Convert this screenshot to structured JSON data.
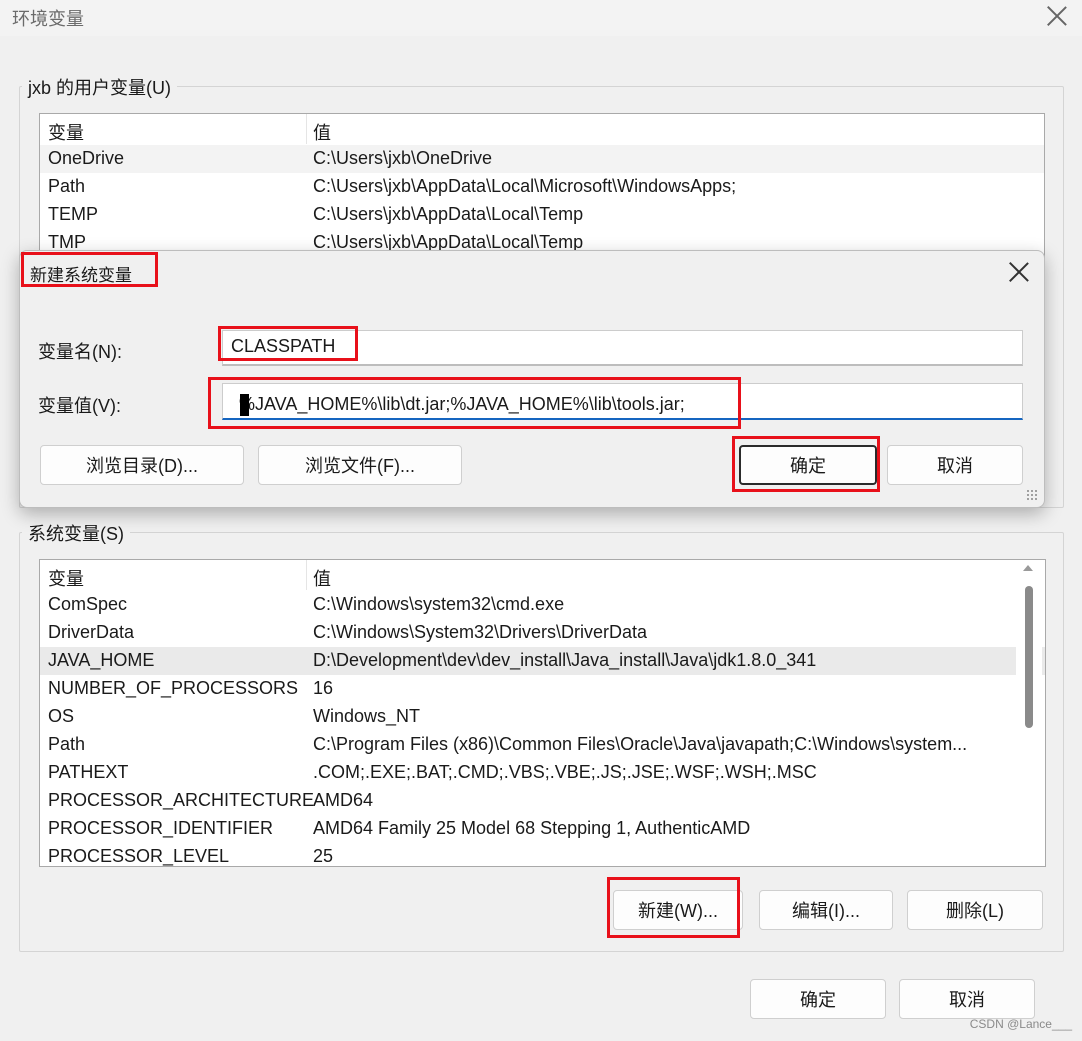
{
  "window": {
    "title": "环境变量"
  },
  "user_vars": {
    "legend": "jxb 的用户变量(U)",
    "headers": [
      "变量",
      "值"
    ],
    "rows": [
      [
        "OneDrive",
        "C:\\Users\\jxb\\OneDrive"
      ],
      [
        "Path",
        "C:\\Users\\jxb\\AppData\\Local\\Microsoft\\WindowsApps;"
      ],
      [
        "TEMP",
        "C:\\Users\\jxb\\AppData\\Local\\Temp"
      ],
      [
        "TMP",
        "C:\\Users\\jxb\\AppData\\Local\\Temp"
      ]
    ]
  },
  "dialog": {
    "title": "新建系统变量",
    "name_label": "变量名(N):",
    "name_value": "CLASSPATH",
    "value_label": "变量值(V):",
    "value_value": "%JAVA_HOME%\\lib\\dt.jar;%JAVA_HOME%\\lib\\tools.jar;",
    "browse_dir": "浏览目录(D)...",
    "browse_file": "浏览文件(F)...",
    "ok": "确定",
    "cancel": "取消"
  },
  "sys_vars": {
    "legend": "系统变量(S)",
    "headers": [
      "变量",
      "值"
    ],
    "rows": [
      [
        "ComSpec",
        "C:\\Windows\\system32\\cmd.exe"
      ],
      [
        "DriverData",
        "C:\\Windows\\System32\\Drivers\\DriverData"
      ],
      [
        "JAVA_HOME",
        "D:\\Development\\dev\\dev_install\\Java_install\\Java\\jdk1.8.0_341"
      ],
      [
        "NUMBER_OF_PROCESSORS",
        "16"
      ],
      [
        "OS",
        "Windows_NT"
      ],
      [
        "Path",
        "C:\\Program Files (x86)\\Common Files\\Oracle\\Java\\javapath;C:\\Windows\\system..."
      ],
      [
        "PATHEXT",
        ".COM;.EXE;.BAT;.CMD;.VBS;.VBE;.JS;.JSE;.WSF;.WSH;.MSC"
      ],
      [
        "PROCESSOR_ARCHITECTURE",
        "AMD64"
      ],
      [
        "PROCESSOR_IDENTIFIER",
        "AMD64 Family 25 Model 68 Stepping 1, AuthenticAMD"
      ],
      [
        "PROCESSOR_LEVEL",
        "25"
      ]
    ],
    "new_btn": "新建(W)...",
    "edit_btn": "编辑(I)...",
    "delete_btn": "删除(L)"
  },
  "footer": {
    "ok": "确定",
    "cancel": "取消"
  },
  "watermark": "CSDN @Lance___",
  "colors": {
    "highlight": "#e8101a",
    "focus": "#1565c0"
  }
}
